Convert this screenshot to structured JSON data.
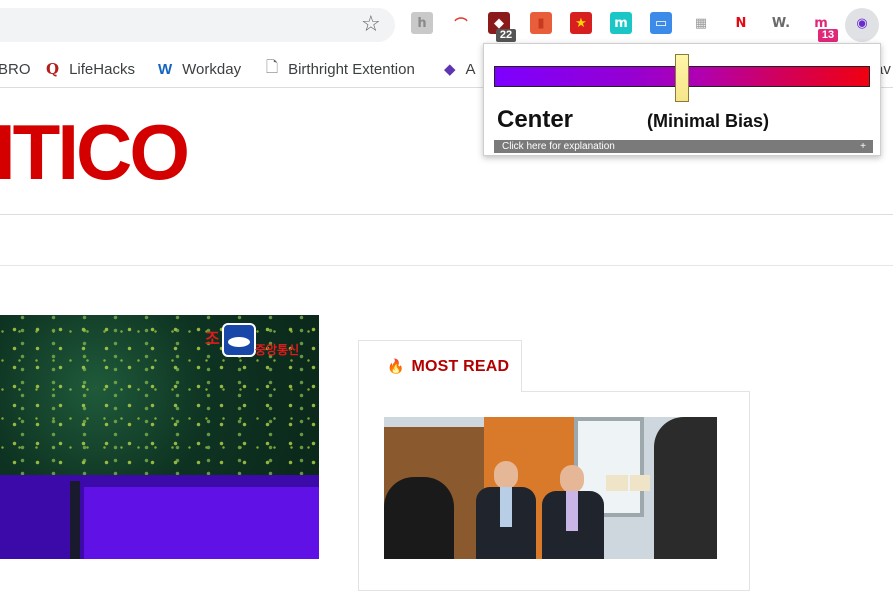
{
  "toolbar": {
    "extensions": [
      {
        "name": "honey",
        "glyph": "h",
        "bg": "#c9c9c9",
        "fg": "#8a8a8a"
      },
      {
        "name": "rainbow",
        "glyph": "⌒",
        "bg": "transparent",
        "fg": "#e2392b"
      },
      {
        "name": "ublock",
        "glyph": "◆",
        "bg": "#8b1a1a",
        "fg": "#ffffff",
        "badge": "22",
        "badge_bg": "#555555"
      },
      {
        "name": "book",
        "glyph": "▮",
        "bg": "#e85d3a",
        "fg": "#c63a1e"
      },
      {
        "name": "star-box",
        "glyph": "★",
        "bg": "#d81f1f",
        "fg": "#ffd400"
      },
      {
        "name": "mercury",
        "glyph": "m",
        "bg": "#1bc6c6",
        "fg": "#ffffff"
      },
      {
        "name": "window",
        "glyph": "▭",
        "bg": "#3d8be8",
        "fg": "#ffffff"
      },
      {
        "name": "grid",
        "glyph": "▦",
        "bg": "transparent",
        "fg": "#9a9a9a"
      },
      {
        "name": "netflix",
        "glyph": "N",
        "bg": "#ffffff",
        "fg": "#e50914"
      },
      {
        "name": "wordtune",
        "glyph": "W.",
        "bg": "transparent",
        "fg": "#6a6a6a"
      },
      {
        "name": "scribe",
        "glyph": "m",
        "bg": "transparent",
        "fg": "#e0287a",
        "badge": "13",
        "badge_bg": "#e0287a"
      },
      {
        "name": "allsides",
        "glyph": "◉",
        "bg": "transparent",
        "fg": "#6b2bd1"
      }
    ]
  },
  "bookmarks": [
    {
      "label": "BRO",
      "icon": ""
    },
    {
      "label": "LifeHacks",
      "icon": "Q",
      "icon_color": "#b71c1c"
    },
    {
      "label": "Workday",
      "icon": "W",
      "icon_color": "#1565c0"
    },
    {
      "label": "Birthright Extention",
      "icon": "🗋",
      "icon_color": "#5f6368"
    },
    {
      "label": "A",
      "icon": "◆",
      "icon_color": "#5e35b1"
    },
    {
      "label": "av",
      "icon": ""
    }
  ],
  "site": {
    "logo_text": "ITICO"
  },
  "hero": {
    "watermark_left": "조",
    "watermark_right": "중앙통신"
  },
  "most_read": {
    "label": "MOST READ",
    "icon": "flame-icon"
  },
  "bias_popup": {
    "rating": "Center",
    "qualifier": "(Minimal Bias)",
    "explain_label": "Click here for explanation",
    "explain_plus": "+",
    "bias_position": 0.5
  }
}
